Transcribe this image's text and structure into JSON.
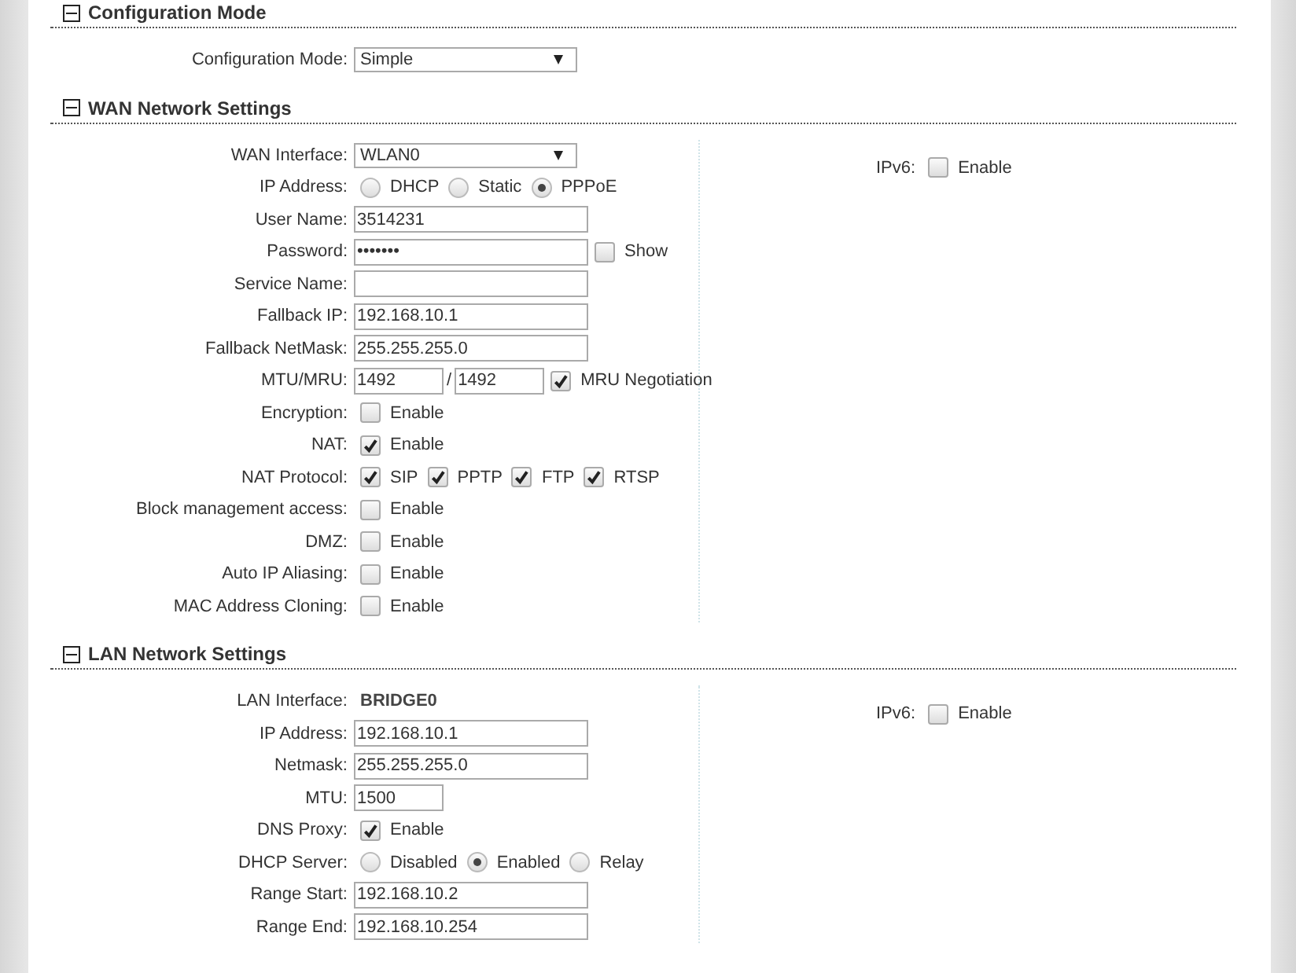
{
  "sections": [
    {
      "title": "Configuration Mode",
      "expanded": true,
      "rows": [
        {
          "kind": "select",
          "label": "Configuration Mode:",
          "value": "Simple"
        }
      ]
    },
    {
      "title": "WAN Network Settings",
      "expanded": true,
      "rows": [
        {
          "kind": "select",
          "label": "WAN Interface:",
          "value": "WLAN0"
        },
        {
          "kind": "radio",
          "label": "IP Address:",
          "options": [
            {
              "label": "DHCP",
              "selected": false
            },
            {
              "label": "Static",
              "selected": false
            },
            {
              "label": "PPPoE",
              "selected": true
            }
          ]
        },
        {
          "kind": "text",
          "label": "User Name:",
          "value": "3514231"
        },
        {
          "kind": "password",
          "label": "Password:",
          "value": "•••••••",
          "extra": {
            "label": "Show",
            "checked": false
          }
        },
        {
          "kind": "text",
          "label": "Service Name:",
          "value": ""
        },
        {
          "kind": "text",
          "label": "Fallback IP:",
          "value": "192.168.10.1"
        },
        {
          "kind": "text",
          "label": "Fallback NetMask:",
          "value": "255.255.255.0"
        },
        {
          "kind": "pair",
          "label": "MTU/MRU:",
          "values": [
            "1492",
            "1492"
          ],
          "separator": "/",
          "extra": {
            "label": "MRU Negotiation",
            "checked": true
          }
        },
        {
          "kind": "checks",
          "label": "Encryption:",
          "options": [
            {
              "label": "Enable",
              "checked": false
            }
          ]
        },
        {
          "kind": "checks",
          "label": "NAT:",
          "options": [
            {
              "label": "Enable",
              "checked": true
            }
          ]
        },
        {
          "kind": "checks",
          "label": "NAT Protocol:",
          "options": [
            {
              "label": "SIP",
              "checked": true
            },
            {
              "label": "PPTP",
              "checked": true
            },
            {
              "label": "FTP",
              "checked": true
            },
            {
              "label": "RTSP",
              "checked": true
            }
          ]
        },
        {
          "kind": "checks",
          "label": "Block management access:",
          "options": [
            {
              "label": "Enable",
              "checked": false
            }
          ]
        },
        {
          "kind": "checks",
          "label": "DMZ:",
          "options": [
            {
              "label": "Enable",
              "checked": false
            }
          ]
        },
        {
          "kind": "checks",
          "label": "Auto IP Aliasing:",
          "options": [
            {
              "label": "Enable",
              "checked": false
            }
          ]
        },
        {
          "kind": "checks",
          "label": "MAC Address Cloning:",
          "options": [
            {
              "label": "Enable",
              "checked": false
            }
          ]
        }
      ],
      "side": {
        "label": "IPv6:",
        "options": [
          {
            "label": "Enable",
            "checked": false
          }
        ]
      }
    },
    {
      "title": "LAN Network Settings",
      "expanded": true,
      "rows": [
        {
          "kind": "static",
          "label": "LAN Interface:",
          "value": "BRIDGE0"
        },
        {
          "kind": "text",
          "label": "IP Address:",
          "value": "192.168.10.1"
        },
        {
          "kind": "text",
          "label": "Netmask:",
          "value": "255.255.255.0"
        },
        {
          "kind": "short",
          "label": "MTU:",
          "value": "1500"
        },
        {
          "kind": "checks",
          "label": "DNS Proxy:",
          "options": [
            {
              "label": "Enable",
              "checked": true
            }
          ]
        },
        {
          "kind": "radio",
          "label": "DHCP Server:",
          "options": [
            {
              "label": "Disabled",
              "selected": false
            },
            {
              "label": "Enabled",
              "selected": true
            },
            {
              "label": "Relay",
              "selected": false
            }
          ]
        },
        {
          "kind": "text",
          "label": "Range Start:",
          "value": "192.168.10.2"
        },
        {
          "kind": "text",
          "label": "Range End:",
          "value": "192.168.10.254"
        }
      ],
      "side": {
        "label": "IPv6:",
        "options": [
          {
            "label": "Enable",
            "checked": false
          }
        ]
      }
    }
  ]
}
